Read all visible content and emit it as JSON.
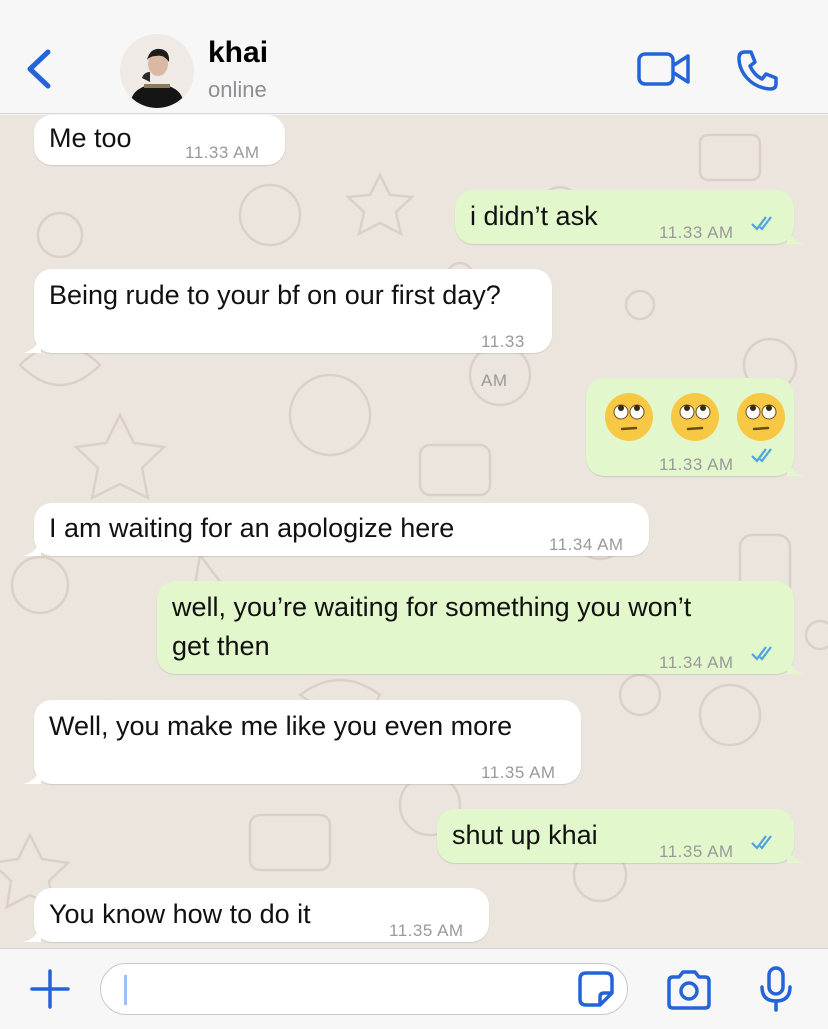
{
  "header": {
    "contact_name": "khai",
    "contact_status": "online"
  },
  "colors": {
    "accent": "#2563d9",
    "incoming_bubble": "#ffffff",
    "outgoing_bubble": "#e2f7cb",
    "chat_background": "#ebe5de",
    "read_ticks": "#4fa3e0"
  },
  "icons": {
    "back": "chevron-left-icon",
    "video": "video-camera-icon",
    "call": "phone-icon",
    "plus": "plus-icon",
    "sticker": "sticker-icon",
    "camera": "camera-icon",
    "mic": "microphone-icon",
    "read_receipt": "double-check-icon"
  },
  "messages": [
    {
      "direction": "in",
      "text": "Me too",
      "time": "11.33 AM"
    },
    {
      "direction": "out",
      "text": "i didn’t ask",
      "time": "11.33 AM",
      "read": true
    },
    {
      "direction": "in",
      "text": "Being rude to your bf on our first day?",
      "time": "11.33 AM"
    },
    {
      "direction": "out",
      "text": "🙄🙄🙄",
      "emoji": "face-with-rolling-eyes",
      "emoji_count": 3,
      "time": "11.33 AM",
      "read": true
    },
    {
      "direction": "in",
      "text": "I am waiting for an apologize here",
      "time": "11.34 AM"
    },
    {
      "direction": "out",
      "text_line1": "well, you’re waiting for something you won’t",
      "text_line2": "get then",
      "time": "11.34 AM",
      "read": true
    },
    {
      "direction": "in",
      "text": "Well, you make me like you even more",
      "time": "11.35 AM"
    },
    {
      "direction": "out",
      "text": "shut up khai",
      "time": "11.35 AM",
      "read": true
    },
    {
      "direction": "in",
      "text": "You know how to do it",
      "time": "11.35 AM"
    }
  ],
  "composer": {
    "value": "",
    "placeholder": ""
  }
}
